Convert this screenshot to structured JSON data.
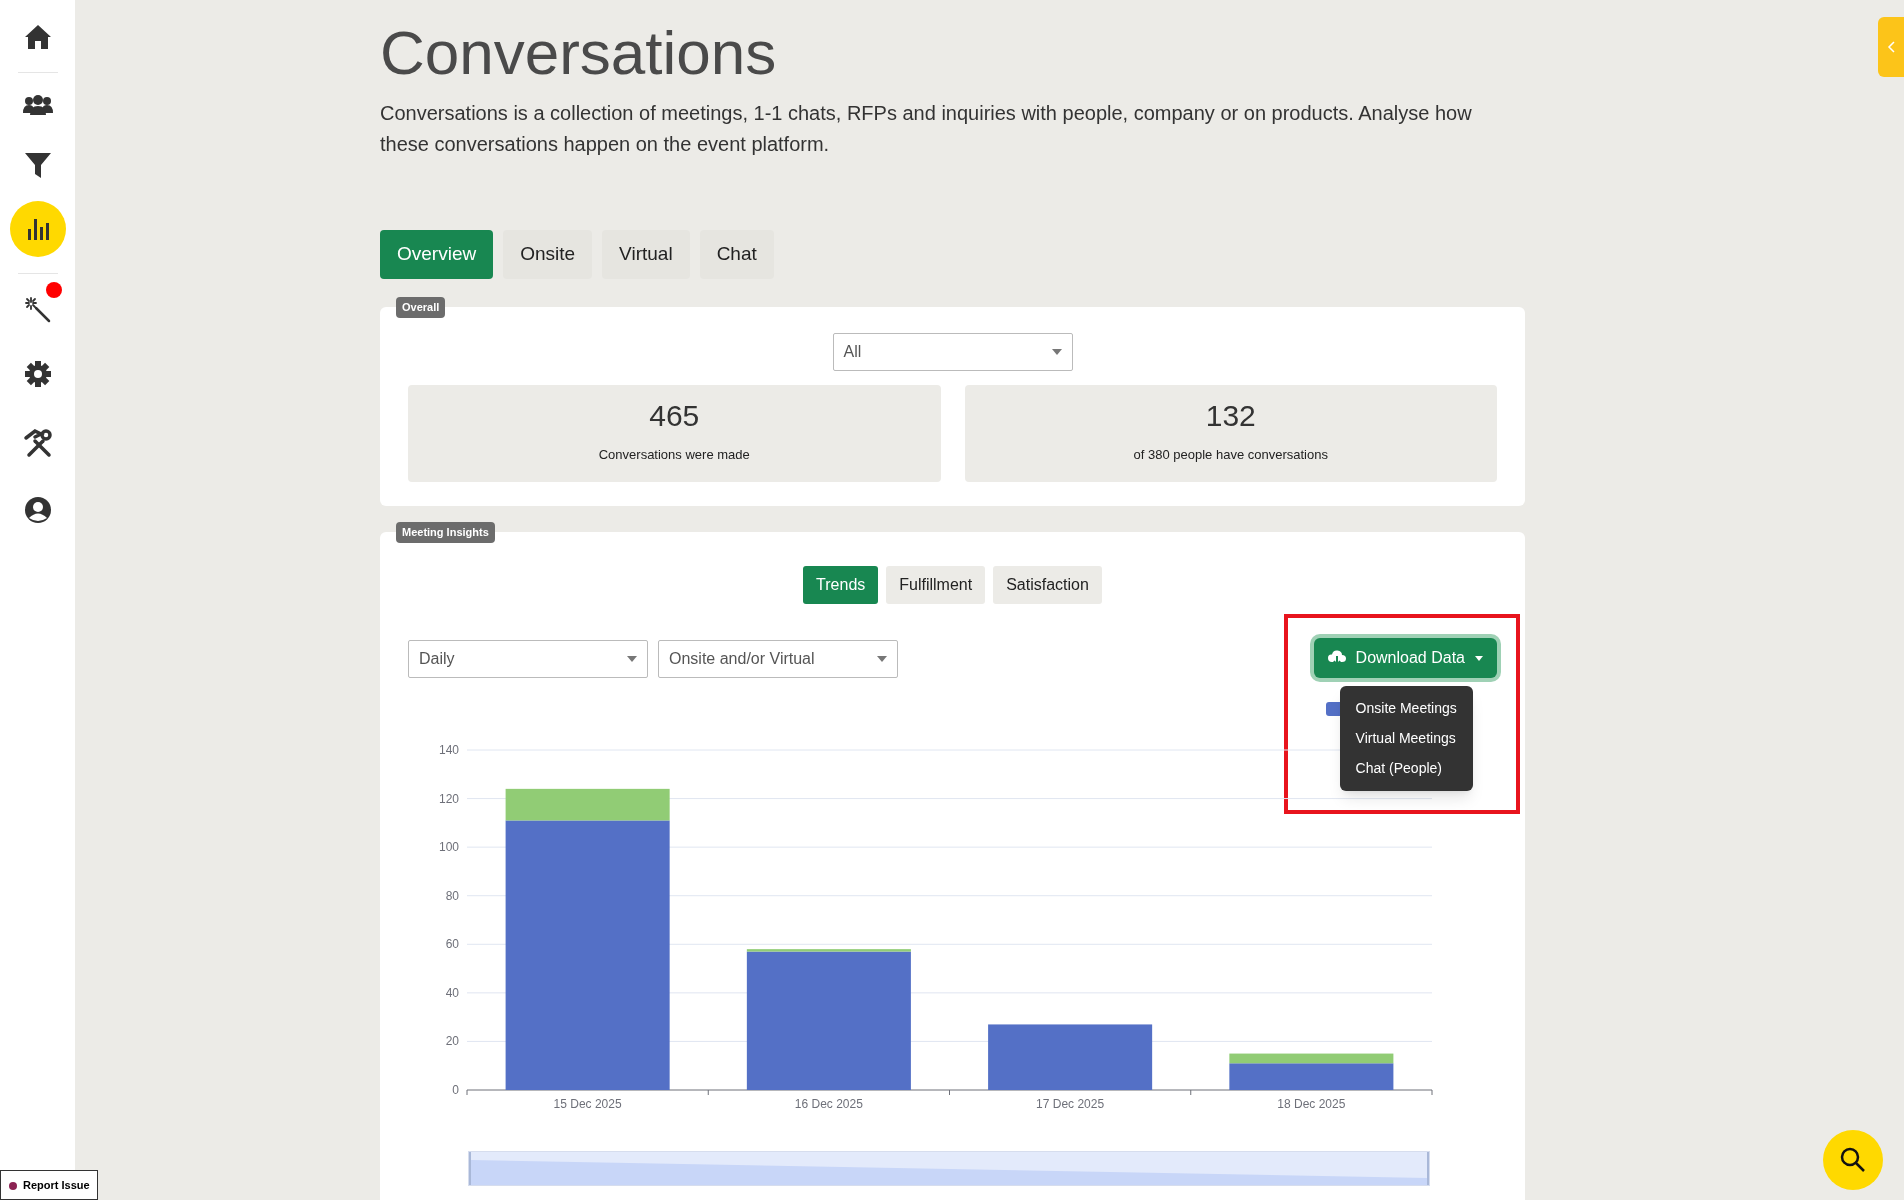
{
  "page": {
    "title": "Conversations",
    "description": "Conversations is a collection of meetings, 1-1 chats, RFPs and inquiries with people, company or on products. Analyse how these conversations happen on the event platform."
  },
  "tabs": [
    {
      "label": "Overview",
      "selected": true
    },
    {
      "label": "Onsite",
      "selected": false
    },
    {
      "label": "Virtual",
      "selected": false
    },
    {
      "label": "Chat",
      "selected": false
    }
  ],
  "overall": {
    "badge": "Overall",
    "filter": {
      "value": "All"
    },
    "stats": [
      {
        "value": "465",
        "caption": "Conversations were made"
      },
      {
        "value": "132",
        "caption": "of 380 people have conversations"
      }
    ]
  },
  "insights": {
    "badge": "Meeting Insights",
    "subtabs": [
      {
        "label": "Trends",
        "selected": true
      },
      {
        "label": "Fulfillment",
        "selected": false
      },
      {
        "label": "Satisfaction",
        "selected": false
      }
    ],
    "filters": [
      {
        "value": "Daily"
      },
      {
        "value": "Onsite and/or Virtual"
      }
    ],
    "download": {
      "label": "Download Data",
      "menu": [
        "Onsite Meetings",
        "Virtual Meetings",
        "Chat (People)"
      ]
    },
    "chart_data": {
      "type": "bar",
      "stacked": true,
      "categories": [
        "15 Dec 2025",
        "16 Dec 2025",
        "17 Dec 2025",
        "18 Dec 2025"
      ],
      "series": [
        {
          "color": "#5470c6",
          "values": [
            111,
            57,
            27,
            11
          ]
        },
        {
          "color": "#91cc75",
          "values": [
            13,
            1,
            0,
            4
          ]
        }
      ],
      "ylim": [
        0,
        140
      ],
      "yticks": [
        0,
        20,
        40,
        60,
        80,
        100,
        120,
        140
      ],
      "grid": true
    },
    "zoom_slider": {
      "level": 1
    }
  },
  "report_issue": "Report Issue"
}
